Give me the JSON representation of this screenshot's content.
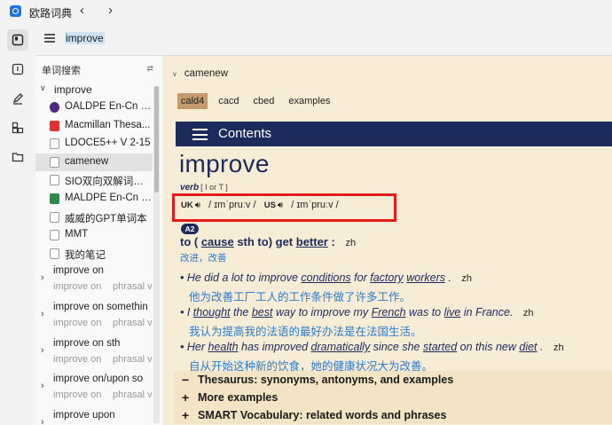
{
  "app": {
    "title": "欧路词典",
    "back": "‹",
    "forward": "›"
  },
  "search": {
    "value": "improve"
  },
  "panel": {
    "header": "单词搜索",
    "root": "improve",
    "dicts": [
      {
        "label": "OALDPE En-Cn V...",
        "icon": "oaldpe-icon",
        "kind": "oal"
      },
      {
        "label": "Macmillan Thesa...",
        "icon": "macmillan-icon",
        "kind": "mac"
      },
      {
        "label": "LDOCE5++ V 2-15",
        "icon": "ldoce-icon",
        "kind": "ldo"
      },
      {
        "label": "camenew",
        "icon": "file-icon",
        "kind": "file",
        "selected": true
      },
      {
        "label": "SIO双向双解词典v...",
        "icon": "file-icon",
        "kind": "file"
      },
      {
        "label": "MALDPE En-Cn V...",
        "icon": "maldpe-icon",
        "kind": "mal"
      },
      {
        "label": "威威的GPT单词本",
        "icon": "file-icon",
        "kind": "file"
      },
      {
        "label": "MMT",
        "icon": "file-icon",
        "kind": "file"
      },
      {
        "label": "我的笔记",
        "icon": "file-icon",
        "kind": "file"
      }
    ],
    "groups": [
      {
        "word": "improve on",
        "sub1": "improve on",
        "sub2": "phrasal v"
      },
      {
        "word": "improve on somethin",
        "sub1": "improve on",
        "sub2": "phrasal v"
      },
      {
        "word": "improve on sth",
        "sub1": "improve on",
        "sub2": "phrasal v"
      },
      {
        "word": "improve on/upon so",
        "sub1": "improve on",
        "sub2": "phrasal v"
      },
      {
        "word": "improve upon",
        "sub1": "",
        "sub2": ""
      }
    ]
  },
  "content": {
    "dict_name": "camenew",
    "tabs": [
      "cald4",
      "cacd",
      "cbed",
      "examples"
    ],
    "contents_label": "Contents",
    "headword": "improve",
    "pos": "verb",
    "grammar": "[ I or T ]",
    "uk_label": "UK",
    "uk_ipa": "/ ɪmˈpruːv /",
    "us_label": "US",
    "us_ipa": "/ ɪmˈpruːv /",
    "level": "A2",
    "zh_tag": "zh",
    "sense_zh": "改进，改善",
    "examples": [
      {
        "en": "He did a lot to improve conditions for factory workers .",
        "zh": "他为改善工厂工人的工作条件做了许多工作。"
      },
      {
        "en": "I thought the best way to improve my French was to live in France.",
        "zh": "我认为提高我的法语的最好办法是在法国生活。"
      },
      {
        "en": "Her health has improved dramatically since she started on this new diet .",
        "zh": "自从开始这种新的饮食，她的健康状况大为改善。"
      }
    ],
    "sections": [
      {
        "sym": "−",
        "label": "Thesaurus: synonyms, antonyms, and examples"
      },
      {
        "sym": "+",
        "label": "More examples"
      },
      {
        "sym": "+",
        "label": "SMART Vocabulary: related words and phrases"
      }
    ]
  }
}
